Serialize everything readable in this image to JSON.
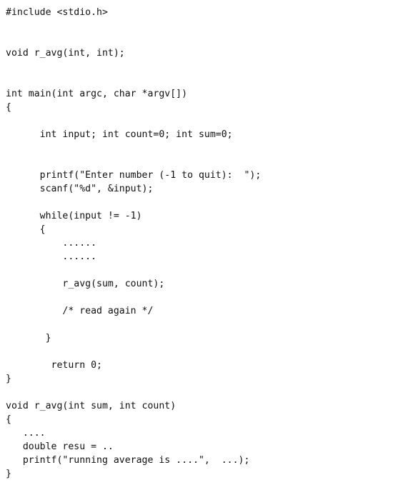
{
  "document": {
    "type": "source-code-listing",
    "language": "c",
    "background_color": "#ffffff",
    "text_color": "#111111",
    "lines": [
      "#include <stdio.h>",
      "",
      "",
      "void r_avg(int, int);",
      "",
      "",
      "int main(int argc, char *argv[])",
      "{",
      "",
      "      int input; int count=0; int sum=0;",
      "",
      "",
      "      printf(\"Enter number (-1 to quit):  \");",
      "      scanf(\"%d\", &input);",
      "",
      "      while(input != -1)",
      "      {",
      "          ......",
      "          ......",
      "",
      "          r_avg(sum, count);",
      "",
      "          /* read again */",
      "",
      "       }",
      "",
      "        return 0;",
      "}",
      "",
      "void r_avg(int sum, int count)",
      "{",
      "   ....",
      "   double resu = ..",
      "   printf(\"running average is ....\",  ...);",
      "}"
    ]
  }
}
